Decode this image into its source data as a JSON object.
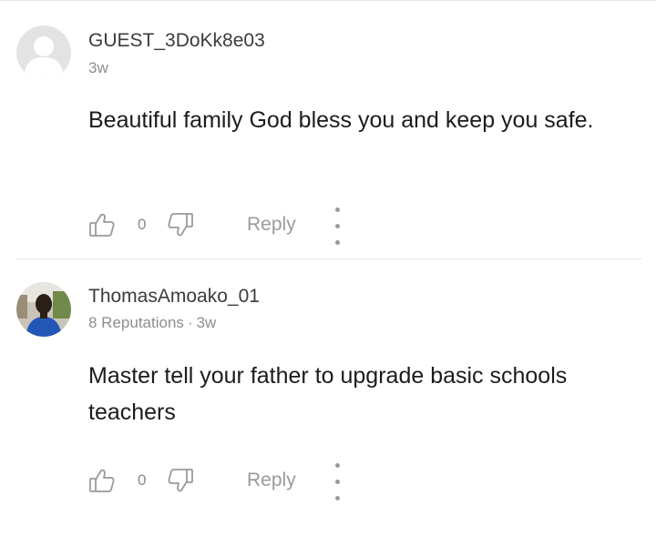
{
  "comments": [
    {
      "username": "GUEST_3DoKk8e03",
      "reputation": "",
      "time": "3w",
      "text": "Beautiful family God bless you and keep you safe.",
      "likes": "0",
      "reply_label": "Reply",
      "avatar": "default-user-avatar"
    },
    {
      "username": "ThomasAmoako_01",
      "reputation": "8 Reputations",
      "time": "3w",
      "text": "Master tell your father to upgrade basic schools teachers",
      "likes": "0",
      "reply_label": "Reply",
      "avatar": "user-photo"
    }
  ],
  "icons": {
    "like": "thumbs-up-icon",
    "dislike": "thumbs-down-icon",
    "more": "more-dots-icon"
  },
  "colors": {
    "text": "#1c1c1c",
    "muted": "#8e8e8e",
    "action": "#9a9a9a",
    "divider": "#e4e4e4"
  }
}
